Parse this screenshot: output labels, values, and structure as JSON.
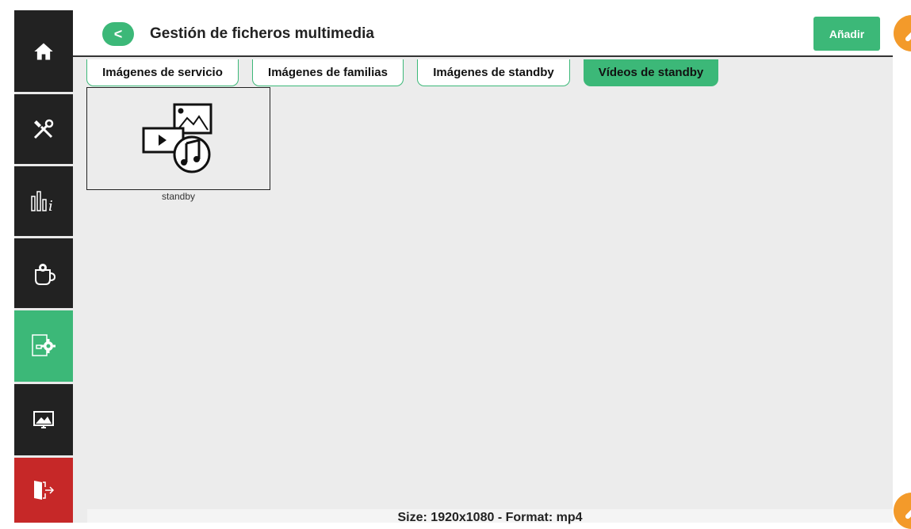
{
  "header": {
    "back_label": "<",
    "title": "Gestión de ficheros multimedia",
    "add_label": "Añadir"
  },
  "sidebar": {
    "items": [
      {
        "icon": "home-icon",
        "color": "#222222"
      },
      {
        "icon": "tools-icon",
        "color": "#222222"
      },
      {
        "icon": "stats-info-icon",
        "color": "#222222"
      },
      {
        "icon": "coffee-cup-gear-icon",
        "color": "#222222"
      },
      {
        "icon": "file-settings-icon",
        "color": "#3cb878",
        "active": true
      },
      {
        "icon": "screen-display-icon",
        "color": "#222222"
      },
      {
        "icon": "exit-door-icon",
        "color": "#c62828"
      }
    ]
  },
  "tabs": [
    {
      "label": "Imágenes de servicio",
      "active": false
    },
    {
      "label": "Imágenes de familias",
      "active": false
    },
    {
      "label": "Imágenes de standby",
      "active": false
    },
    {
      "label": "Vídeos de standby",
      "active": true
    }
  ],
  "files": [
    {
      "name": "standby",
      "icon": "multimedia-icon"
    }
  ],
  "footer": {
    "info": "Size: 1920x1080 - Format: mp4"
  },
  "colors": {
    "accent": "#3cb878",
    "sidebar": "#222222",
    "exit": "#c62828",
    "deco": "#f39a2a"
  }
}
